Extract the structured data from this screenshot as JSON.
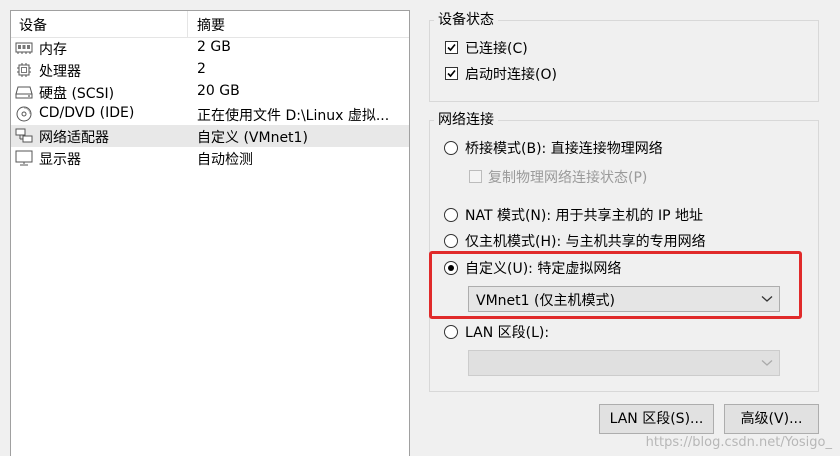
{
  "device_list": {
    "columns": {
      "device": "设备",
      "summary": "摘要"
    },
    "rows": [
      {
        "icon": "memory-icon",
        "name": "内存",
        "summary": "2 GB"
      },
      {
        "icon": "processor-icon",
        "name": "处理器",
        "summary": "2"
      },
      {
        "icon": "harddisk-icon",
        "name": "硬盘 (SCSI)",
        "summary": "20 GB"
      },
      {
        "icon": "cd-dvd-icon",
        "name": "CD/DVD (IDE)",
        "summary": "正在使用文件 D:\\Linux 虚拟..."
      },
      {
        "icon": "network-adapter-icon",
        "name": "网络适配器",
        "summary": "自定义 (VMnet1)",
        "selected": true
      },
      {
        "icon": "display-icon",
        "name": "显示器",
        "summary": "自动检测"
      }
    ]
  },
  "device_status": {
    "title": "设备状态",
    "connected": {
      "label": "已连接(C)",
      "checked": true
    },
    "connect_at_power_on": {
      "label": "启动时连接(O)",
      "checked": true
    }
  },
  "network_connection": {
    "title": "网络连接",
    "bridged": {
      "label": "桥接模式(B): 直接连接物理网络"
    },
    "replicate": {
      "label": "复制物理网络连接状态(P)",
      "disabled": true
    },
    "nat": {
      "label": "NAT 模式(N): 用于共享主机的 IP 地址"
    },
    "host_only": {
      "label": "仅主机模式(H): 与主机共享的专用网络"
    },
    "custom": {
      "label": "自定义(U): 特定虚拟网络",
      "selected": true
    },
    "custom_network_select": {
      "value": "VMnet1 (仅主机模式)"
    },
    "lan_segment": {
      "label": "LAN 区段(L):"
    },
    "lan_segment_select": {
      "value": "",
      "disabled": true
    }
  },
  "buttons": {
    "lan_segments": "LAN 区段(S)...",
    "advanced": "高级(V)..."
  },
  "watermark": "https://blog.csdn.net/Yosigo_",
  "colors": {
    "highlight": "#e02a2a",
    "selected_row": "#e8e8e8"
  }
}
